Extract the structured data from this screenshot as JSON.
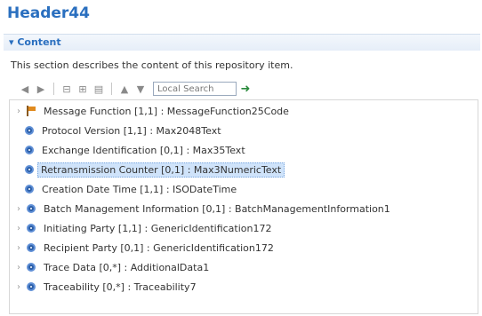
{
  "header": {
    "title": "Header44"
  },
  "section": {
    "toggle_label": "▾ Content",
    "description": "This section describes the content of this repository item."
  },
  "toolbar": {
    "buttons": [
      {
        "icon": "back-arrow-icon",
        "glyph": "◀"
      },
      {
        "icon": "forward-arrow-icon",
        "glyph": "▶"
      },
      {
        "icon": "collapse-all-icon",
        "glyph": "⊟"
      },
      {
        "icon": "expand-all-icon",
        "glyph": "⊞"
      },
      {
        "icon": "filter-icon",
        "glyph": "▤"
      },
      {
        "icon": "up-arrow-icon",
        "glyph": "▲"
      },
      {
        "icon": "down-arrow-icon",
        "glyph": "▼"
      }
    ],
    "search_value": "Local Search",
    "search_go_icon": "search-go-icon"
  },
  "tree": {
    "rows": [
      {
        "label": "Message Function [1,1] : MessageFunction25Code",
        "expandable": true,
        "icon": "flag",
        "selected": false
      },
      {
        "label": "Protocol Version [1,1] : Max2048Text",
        "expandable": false,
        "icon": "node",
        "selected": false
      },
      {
        "label": "Exchange Identification [0,1] : Max35Text",
        "expandable": false,
        "icon": "node",
        "selected": false
      },
      {
        "label": "Retransmission Counter [0,1] : Max3NumericText",
        "expandable": false,
        "icon": "node",
        "selected": true
      },
      {
        "label": "Creation Date Time [1,1] : ISODateTime",
        "expandable": false,
        "icon": "node",
        "selected": false
      },
      {
        "label": "Batch Management Information [0,1] : BatchManagementInformation1",
        "expandable": true,
        "icon": "node",
        "selected": false
      },
      {
        "label": "Initiating Party [1,1] : GenericIdentification172",
        "expandable": true,
        "icon": "node",
        "selected": false
      },
      {
        "label": "Recipient Party [0,1] : GenericIdentification172",
        "expandable": true,
        "icon": "node",
        "selected": false
      },
      {
        "label": "Trace Data [0,*] : AdditionalData1",
        "expandable": true,
        "icon": "node",
        "selected": false
      },
      {
        "label": "Traceability [0,*] : Traceability7",
        "expandable": true,
        "icon": "node",
        "selected": false
      }
    ]
  },
  "colors": {
    "accent": "#2a6fbf",
    "selection": "#cfe3fa",
    "node_icon": "#2c5fa8",
    "flag_icon": "#e08a1e"
  }
}
